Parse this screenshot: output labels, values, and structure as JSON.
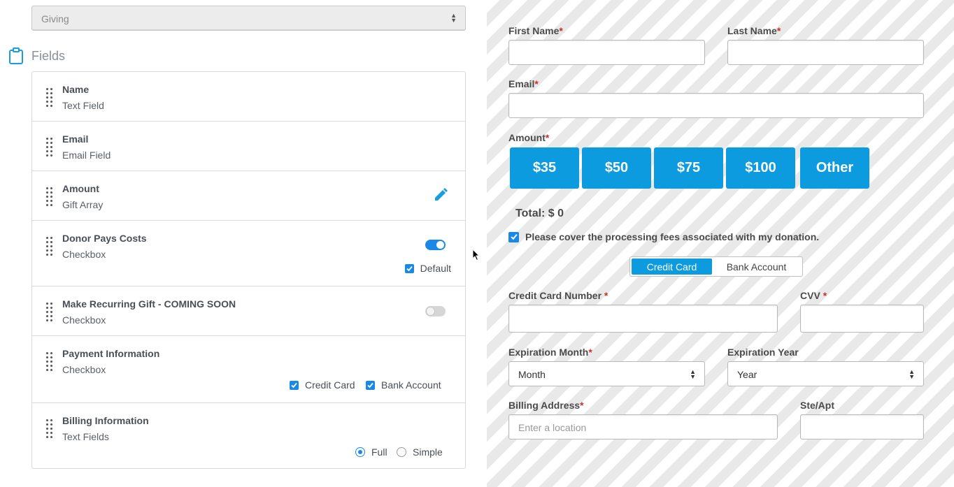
{
  "builder": {
    "form_type": "Giving",
    "fields_title": "Fields",
    "fields": [
      {
        "name": "Name",
        "type": "Text Field"
      },
      {
        "name": "Email",
        "type": "Email Field"
      },
      {
        "name": "Amount",
        "type": "Gift Array"
      },
      {
        "name": "Donor Pays Costs",
        "type": "Checkbox",
        "toggle": "on",
        "default_label": "Default",
        "default_checked": true
      },
      {
        "name": "Make Recurring Gift - COMING SOON",
        "type": "Checkbox",
        "toggle": "off"
      },
      {
        "name": "Payment Information",
        "type": "Checkbox",
        "options": [
          {
            "label": "Credit Card",
            "checked": true
          },
          {
            "label": "Bank Account",
            "checked": true
          }
        ]
      },
      {
        "name": "Billing Information",
        "type": "Text Fields",
        "radios": [
          {
            "label": "Full",
            "selected": true
          },
          {
            "label": "Simple",
            "selected": false
          }
        ]
      }
    ]
  },
  "preview": {
    "first_name_label": "First Name",
    "last_name_label": "Last Name",
    "email_label": "Email",
    "amount_label": "Amount",
    "amounts": [
      "$35",
      "$50",
      "$75",
      "$100",
      "Other"
    ],
    "total": "Total: $ 0",
    "fee_text": "Please cover the processing fees associated with my donation.",
    "fee_checked": true,
    "payment_tabs": [
      "Credit Card",
      "Bank Account"
    ],
    "payment_active": "Credit Card",
    "cc_number_label": "Credit Card Number",
    "cvv_label": "CVV",
    "exp_month_label": "Expiration Month",
    "exp_month_value": "Month",
    "exp_year_label": "Expiration Year",
    "exp_year_value": "Year",
    "billing_address_label": "Billing Address",
    "billing_address_placeholder": "Enter a location",
    "ste_apt_label": "Ste/Apt",
    "required_marker": "*"
  },
  "colors": {
    "accent": "#0d9be0",
    "toggle_on": "#1a88e8",
    "required": "#c9302c"
  }
}
